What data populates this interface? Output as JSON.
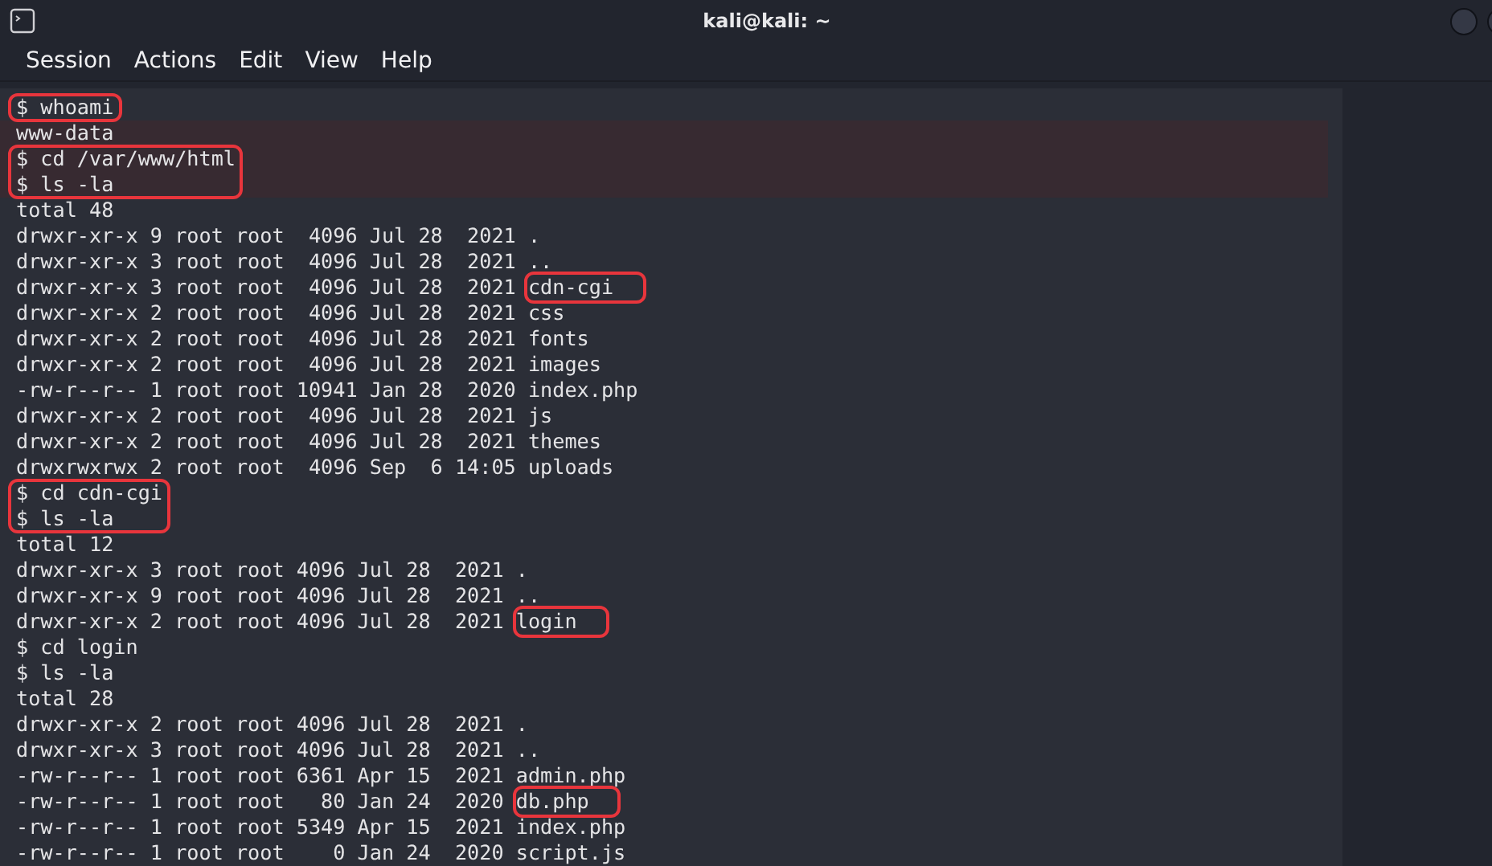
{
  "window": {
    "title": "kali@kali: ~"
  },
  "menu": [
    "Session",
    "Actions",
    "Edit",
    "View",
    "Help"
  ],
  "terminal": {
    "sections": [
      {
        "boxed": true,
        "shaded": false,
        "lines": [
          {
            "text": "$ whoami"
          }
        ]
      },
      {
        "boxed": false,
        "shaded": true,
        "lines": [
          {
            "text": "www-data"
          }
        ]
      },
      {
        "boxed": true,
        "shaded": true,
        "lines": [
          {
            "text": "$ cd /var/www/html"
          },
          {
            "text": "$ ls -la"
          }
        ]
      },
      {
        "boxed": false,
        "shaded": false,
        "lines": [
          {
            "text": "total 48"
          },
          {
            "text": "drwxr-xr-x 9 root root  4096 Jul 28  2021 ",
            "file": ".",
            "file_boxed": false
          },
          {
            "text": "drwxr-xr-x 3 root root  4096 Jul 28  2021 ",
            "file": "..",
            "file_boxed": false
          },
          {
            "text": "drwxr-xr-x 3 root root  4096 Jul 28  2021 ",
            "file": "cdn-cgi",
            "file_boxed": true
          },
          {
            "text": "drwxr-xr-x 2 root root  4096 Jul 28  2021 ",
            "file": "css",
            "file_boxed": false
          },
          {
            "text": "drwxr-xr-x 2 root root  4096 Jul 28  2021 ",
            "file": "fonts",
            "file_boxed": false
          },
          {
            "text": "drwxr-xr-x 2 root root  4096 Jul 28  2021 ",
            "file": "images",
            "file_boxed": false
          },
          {
            "text": "-rw-r--r-- 1 root root 10941 Jan 28  2020 ",
            "file": "index.php",
            "file_boxed": false
          },
          {
            "text": "drwxr-xr-x 2 root root  4096 Jul 28  2021 ",
            "file": "js",
            "file_boxed": false
          },
          {
            "text": "drwxr-xr-x 2 root root  4096 Jul 28  2021 ",
            "file": "themes",
            "file_boxed": false
          },
          {
            "text": "drwxrwxrwx 2 root root  4096 Sep  6 14:05 ",
            "file": "uploads",
            "file_boxed": false
          }
        ]
      },
      {
        "boxed": true,
        "shaded": false,
        "lines": [
          {
            "text": "$ cd cdn-cgi"
          },
          {
            "text": "$ ls -la"
          }
        ]
      },
      {
        "boxed": false,
        "shaded": false,
        "lines": [
          {
            "text": "total 12"
          },
          {
            "text": "drwxr-xr-x 3 root root 4096 Jul 28  2021 ",
            "file": ".",
            "file_boxed": false
          },
          {
            "text": "drwxr-xr-x 9 root root 4096 Jul 28  2021 ",
            "file": "..",
            "file_boxed": false
          },
          {
            "text": "drwxr-xr-x 2 root root 4096 Jul 28  2021 ",
            "file": "login",
            "file_boxed": true
          },
          {
            "text": "$ cd login"
          },
          {
            "text": "$ ls -la"
          },
          {
            "text": "total 28"
          },
          {
            "text": "drwxr-xr-x 2 root root 4096 Jul 28  2021 ",
            "file": ".",
            "file_boxed": false
          },
          {
            "text": "drwxr-xr-x 3 root root 4096 Jul 28  2021 ",
            "file": "..",
            "file_boxed": false
          },
          {
            "text": "-rw-r--r-- 1 root root 6361 Apr 15  2021 ",
            "file": "admin.php",
            "file_boxed": false
          },
          {
            "text": "-rw-r--r-- 1 root root   80 Jan 24  2020 ",
            "file": "db.php",
            "file_boxed": true
          },
          {
            "text": "-rw-r--r-- 1 root root 5349 Apr 15  2021 ",
            "file": "index.php",
            "file_boxed": false
          },
          {
            "text": "-rw-r--r-- 1 root root    0 Jan 24  2020 ",
            "file": "script.js",
            "file_boxed": false
          }
        ]
      }
    ]
  }
}
